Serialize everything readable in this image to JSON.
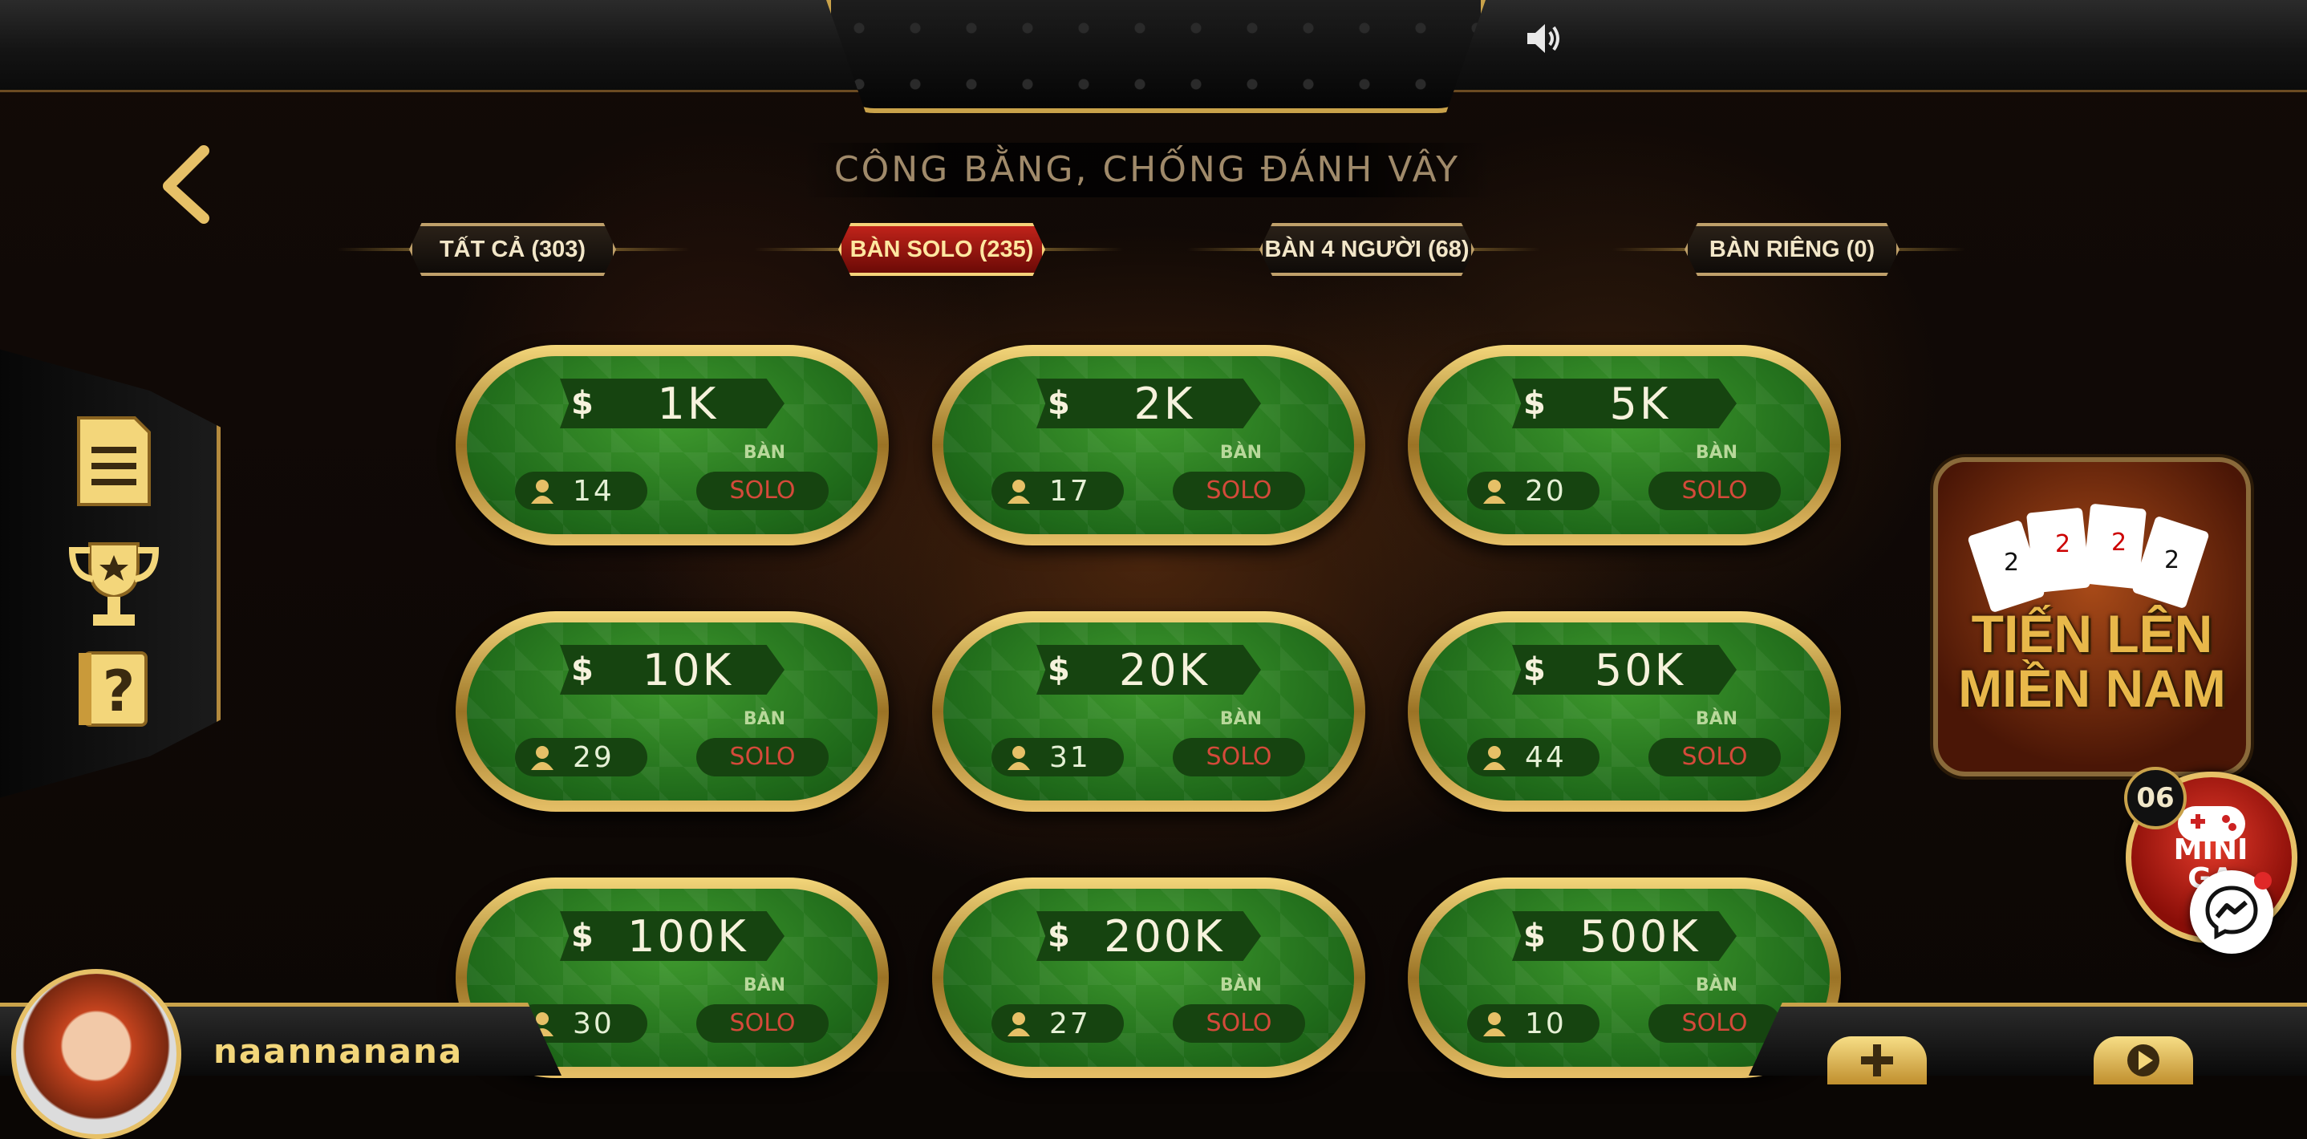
{
  "header": {
    "sound_icon": "speaker-icon"
  },
  "slogan": "CÔNG BẰNG, CHỐNG ĐÁNH VÂY",
  "tabs": [
    {
      "label": "TẤT CẢ (303)",
      "active": false
    },
    {
      "label": "BÀN SOLO (235)",
      "active": true
    },
    {
      "label": "BÀN 4 NGƯỜI (68)",
      "active": false
    },
    {
      "label": "BÀN RIÊNG (0)",
      "active": false
    }
  ],
  "sidebar": {
    "icons": [
      "document-icon",
      "trophy-icon",
      "help-icon"
    ]
  },
  "tables": [
    {
      "price": "1K",
      "players": "14",
      "ban": "BÀN",
      "mode": "SOLO"
    },
    {
      "price": "2K",
      "players": "17",
      "ban": "BÀN",
      "mode": "SOLO"
    },
    {
      "price": "5K",
      "players": "20",
      "ban": "BÀN",
      "mode": "SOLO"
    },
    {
      "price": "10K",
      "players": "29",
      "ban": "BÀN",
      "mode": "SOLO"
    },
    {
      "price": "20K",
      "players": "31",
      "ban": "BÀN",
      "mode": "SOLO"
    },
    {
      "price": "50K",
      "players": "44",
      "ban": "BÀN",
      "mode": "SOLO"
    },
    {
      "price": "100K",
      "players": "30",
      "ban": "BÀN",
      "mode": "SOLO"
    },
    {
      "price": "200K",
      "players": "27",
      "ban": "BÀN",
      "mode": "SOLO"
    },
    {
      "price": "500K",
      "players": "10",
      "ban": "BÀN",
      "mode": "SOLO"
    }
  ],
  "currency_symbol": "$",
  "promo": {
    "title_line1": "TIẾN LÊN",
    "title_line2": "MIỀN NAM"
  },
  "minigame": {
    "count": "06",
    "label": "MINI GA"
  },
  "user": {
    "name": "naannanana"
  },
  "colors": {
    "gold": "#e6c067",
    "felt": "#2a7a1f",
    "solo_red": "#d44a3a",
    "active_tab": "#c0231a"
  }
}
